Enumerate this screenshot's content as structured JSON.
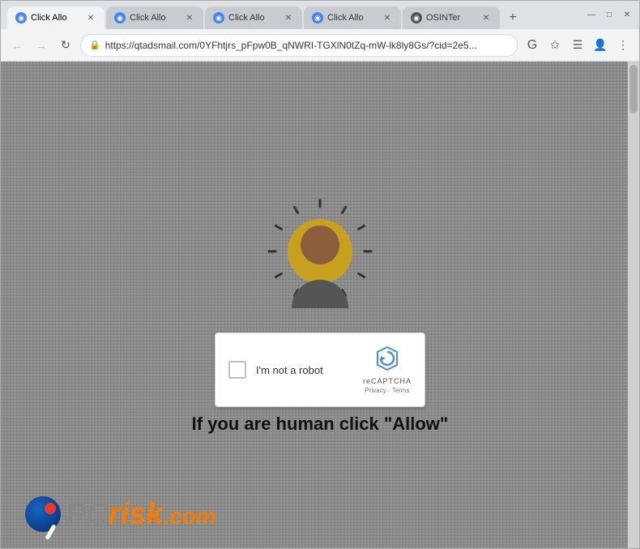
{
  "browser": {
    "tabs": [
      {
        "id": 1,
        "title": "Click Allo",
        "favicon_color": "#4285f4",
        "active": true
      },
      {
        "id": 2,
        "title": "Click Allo",
        "favicon_color": "#4285f4",
        "active": false
      },
      {
        "id": 3,
        "title": "Click Allo",
        "favicon_color": "#4285f4",
        "active": false
      },
      {
        "id": 4,
        "title": "Click Allo",
        "favicon_color": "#4285f4",
        "active": false
      },
      {
        "id": 5,
        "title": "OSINTer",
        "favicon_color": "#555",
        "active": false
      }
    ],
    "url": "https://qtadsmail.com/0YFhtjrs_pFpw0B_qNWRI-TGXlN0tZq-mW-lk8ly8Gs/?cid=2e5...",
    "new_tab_label": "+",
    "window_controls": {
      "minimize": "—",
      "maximize": "□",
      "close": "✕"
    }
  },
  "nav": {
    "back_label": "←",
    "forward_label": "→",
    "refresh_label": "↻"
  },
  "page": {
    "recaptcha": {
      "checkbox_label": "I'm not a robot",
      "brand": "reCAPTCHA",
      "links": "Privacy - Terms"
    },
    "heading": "If you are human click \"Allow\"",
    "logo": {
      "pc_text": "PC",
      "risk_text": "risk",
      "com_text": ".com"
    }
  },
  "colors": {
    "browser_bg": "#dee1e6",
    "tab_active": "#f1f3f4",
    "tab_inactive": "#c8cbd0",
    "page_bg": "#8c8c8c",
    "bulb_color": "#c8a020",
    "head_color": "#8b5e3c",
    "accent_blue": "#4285f4",
    "logo_orange": "#f57c00",
    "logo_gray": "#888"
  }
}
